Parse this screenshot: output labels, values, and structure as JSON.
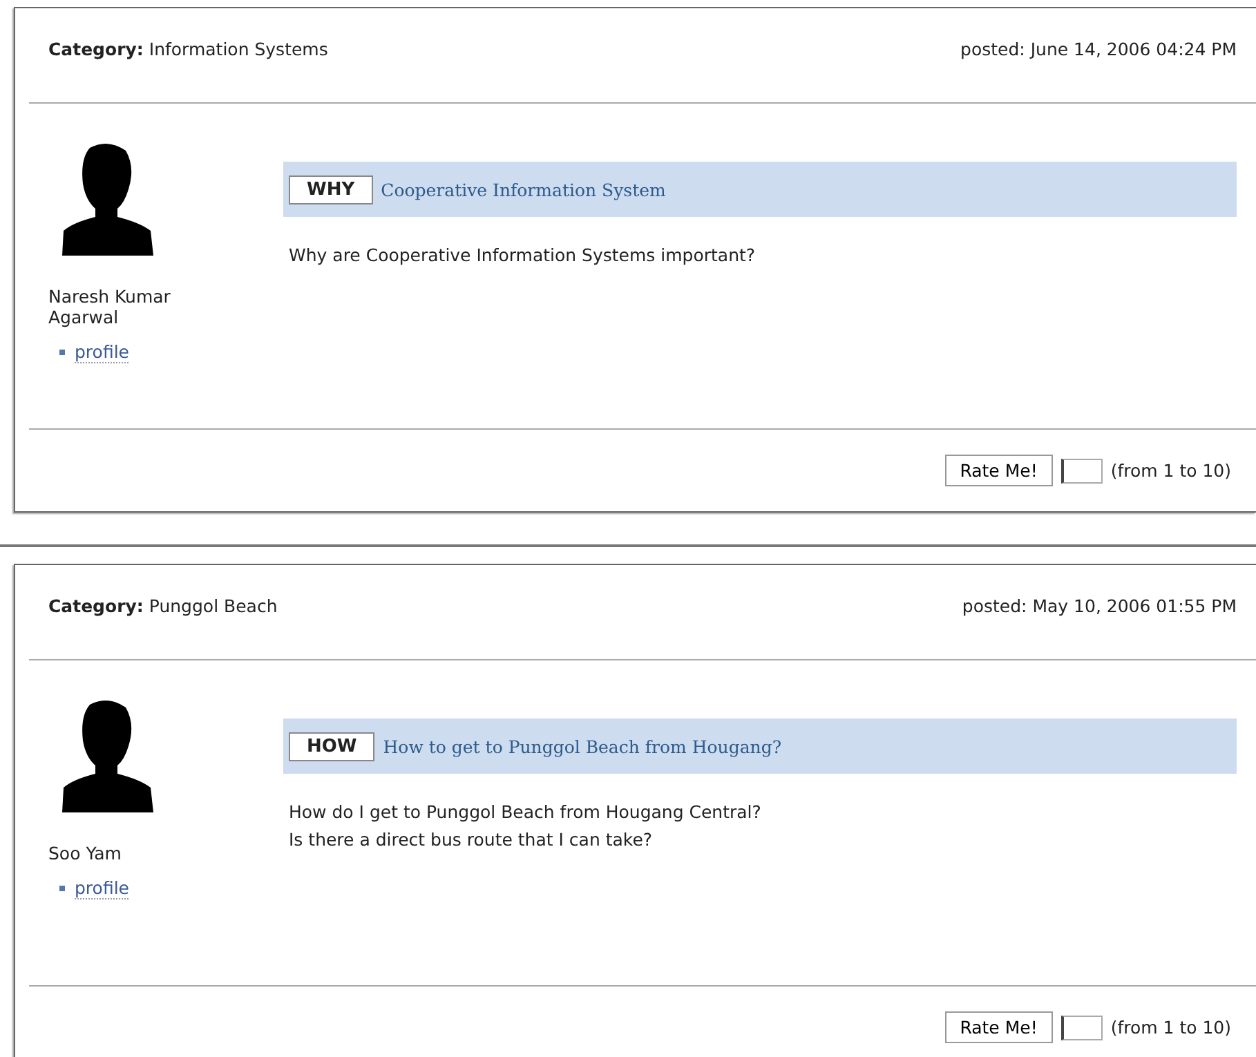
{
  "posts": [
    {
      "category_label": "Category:",
      "category": "Information Systems",
      "posted": "posted: June 14, 2006 04:24 PM",
      "author_lines": [
        "Naresh Kumar",
        "Agarwal"
      ],
      "profile_link": "profile",
      "question_type": "WHY",
      "title": "Cooperative Information System",
      "body_lines": [
        "Why are Cooperative Information Systems important?"
      ],
      "rate_button": "Rate Me!",
      "rate_hint": "(from 1 to 10)"
    },
    {
      "category_label": "Category:",
      "category": "Punggol Beach",
      "posted": "posted: May 10, 2006 01:55 PM",
      "author_lines": [
        "Soo Yam"
      ],
      "profile_link": "profile",
      "question_type": "HOW",
      "title": "How to get to Punggol Beach from Hougang?",
      "body_lines": [
        "How do I get to Punggol Beach from Hougang Central?",
        "Is there a direct bus route that I can take?"
      ],
      "rate_button": "Rate Me!",
      "rate_hint": "(from 1 to 10)"
    }
  ]
}
